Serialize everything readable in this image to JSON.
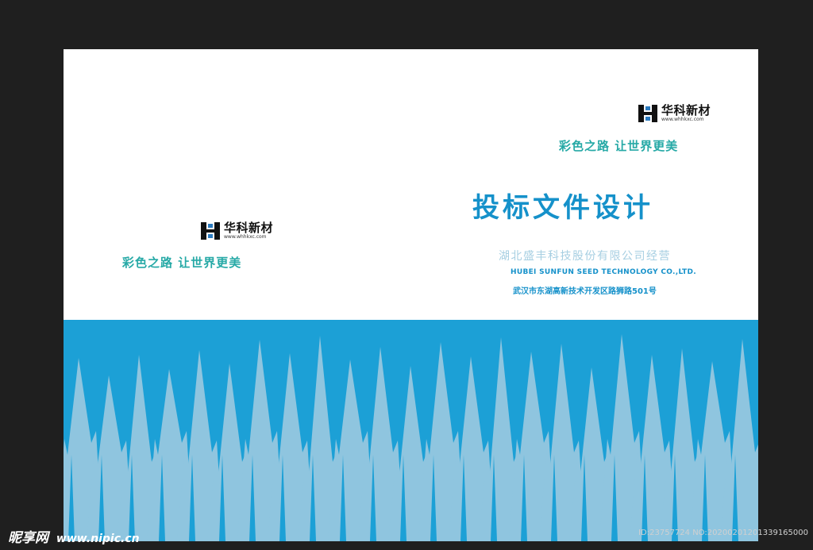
{
  "colors": {
    "background": "#1f1f1f",
    "blue_band": "#1ca0d6",
    "spikes": "#8fc5df",
    "slogan": "#26a9a6",
    "title": "#1591ca"
  },
  "left_panel": {
    "logo": {
      "brand": "华科新材",
      "url": "www.whhkxc.com",
      "icon": "hk-logo-icon"
    },
    "slogan": "彩色之路 让世界更美"
  },
  "right_panel": {
    "logo": {
      "brand": "华科新材",
      "url": "www.whhkxc.com",
      "icon": "hk-logo-icon"
    },
    "slogan": "彩色之路 让世界更美",
    "title": "投标文件设计",
    "company_cn": "湖北盛丰科技股份有限公司经营",
    "company_en": "HUBEI SUNFUN SEED TECHNOLOGY CO.,LTD.",
    "address": "武汉市东湖高新技术开发区路狮路501号"
  },
  "watermark": {
    "brand": "昵享网",
    "site": "www.nipic.cn"
  },
  "image_id": "ID:23757724 NO:20200201201339165000"
}
